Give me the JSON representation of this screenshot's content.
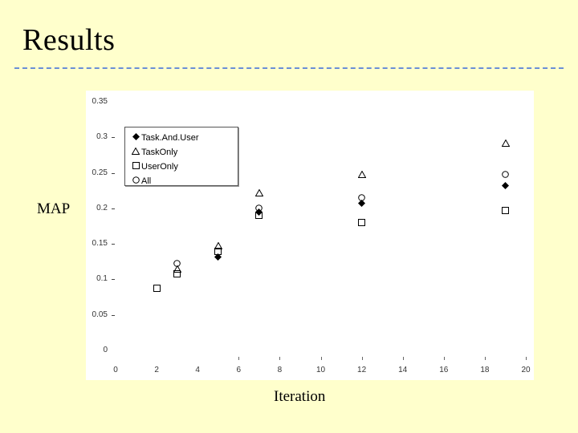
{
  "slide": {
    "title": "Results"
  },
  "chart_data": {
    "type": "scatter",
    "title": "",
    "xlabel": "Iteration",
    "ylabel": "MAP",
    "xlim": [
      0,
      20
    ],
    "ylim": [
      0,
      0.35
    ],
    "grid": false,
    "legend_position": "upper-left",
    "xticks": [
      "0",
      "2",
      "4",
      "6",
      "8",
      "10",
      "12",
      "14",
      "16",
      "18",
      "20"
    ],
    "yticks": [
      "0",
      "0.05",
      "0.1",
      "0.15",
      "0.2",
      "0.25",
      "0.3",
      "0.35"
    ],
    "series": [
      {
        "name": "Task.And.User",
        "marker": "filled-diamond",
        "x": [
          5,
          7,
          12,
          19
        ],
        "y": [
          0.131,
          0.195,
          0.207,
          0.232
        ]
      },
      {
        "name": "TaskOnly",
        "marker": "triangle",
        "x": [
          3,
          5,
          7,
          12,
          19
        ],
        "y": [
          0.115,
          0.147,
          0.222,
          0.248,
          0.292
        ]
      },
      {
        "name": "UserOnly",
        "marker": "square",
        "x": [
          2,
          3,
          5,
          7,
          12,
          19
        ],
        "y": [
          0.088,
          0.108,
          0.139,
          0.19,
          0.18,
          0.197
        ]
      },
      {
        "name": "All",
        "marker": "circle",
        "x": [
          3,
          7,
          12,
          19
        ],
        "y": [
          0.122,
          0.2,
          0.215,
          0.248
        ]
      }
    ]
  }
}
